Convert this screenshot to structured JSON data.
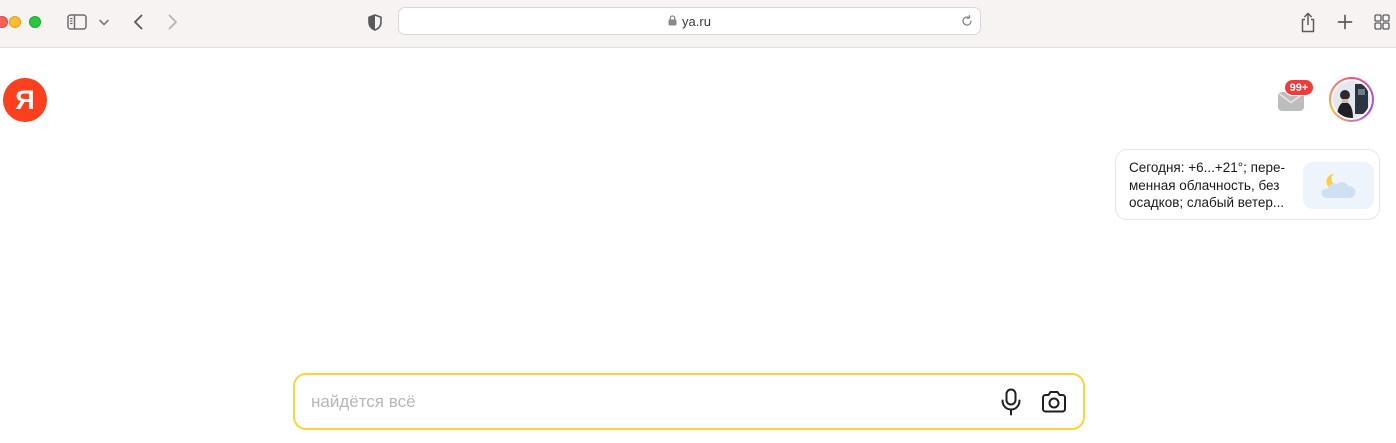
{
  "browser": {
    "url": "ya.ru",
    "icons": {
      "sidebar": "sidebar-icon",
      "tab_overview_chevron": "chevron-down-icon",
      "back": "chevron-left-icon",
      "forward": "chevron-right-icon",
      "privacy": "shield-icon",
      "lock": "lock-icon",
      "reload": "reload-icon",
      "share": "share-icon",
      "new_tab": "plus-icon",
      "tab_overview": "grid-icon"
    }
  },
  "page": {
    "logo_letter": "Я",
    "mail": {
      "badge": "99+",
      "icon": "mail-icon"
    },
    "weather": {
      "lines": [
        "Сегодня: +6...+21°; пере-",
        "менная облачность, без",
        "осадков; слабый ветер..."
      ],
      "icon": "moon-cloud-icon"
    },
    "search": {
      "placeholder": "найдётся всё",
      "value": "",
      "mic_icon": "microphone-icon",
      "camera_icon": "camera-search-icon"
    }
  },
  "colors": {
    "logo": "#fc3f1d",
    "search_border": "#ffd23f",
    "mail_badge": "#f33a3a"
  }
}
